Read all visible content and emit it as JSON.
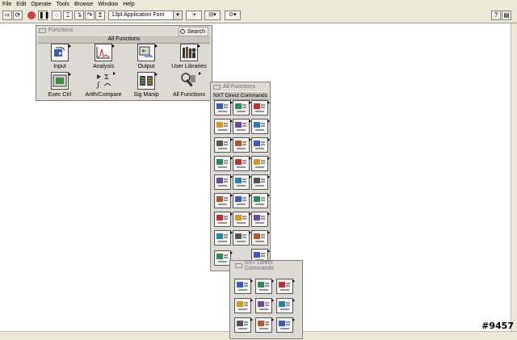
{
  "menu": [
    "File",
    "Edit",
    "Operate",
    "Tools",
    "Browse",
    "Window",
    "Help"
  ],
  "toolbar": {
    "font": "13pt Application Font"
  },
  "palette_main": {
    "header": "Functions",
    "title": "All Functions",
    "search": "Search",
    "items": [
      "Input",
      "Analysis",
      "Output",
      "User Libraries",
      "Exec Ctrl",
      "Arith/Compare",
      "Sig Manip",
      "All Functions"
    ]
  },
  "palette_nxt": {
    "header": "All Functions",
    "title": "NXT Direct Commands"
  },
  "palette_nxt2": {
    "header": "NXT Direct Commands"
  },
  "watermark": "#9457"
}
